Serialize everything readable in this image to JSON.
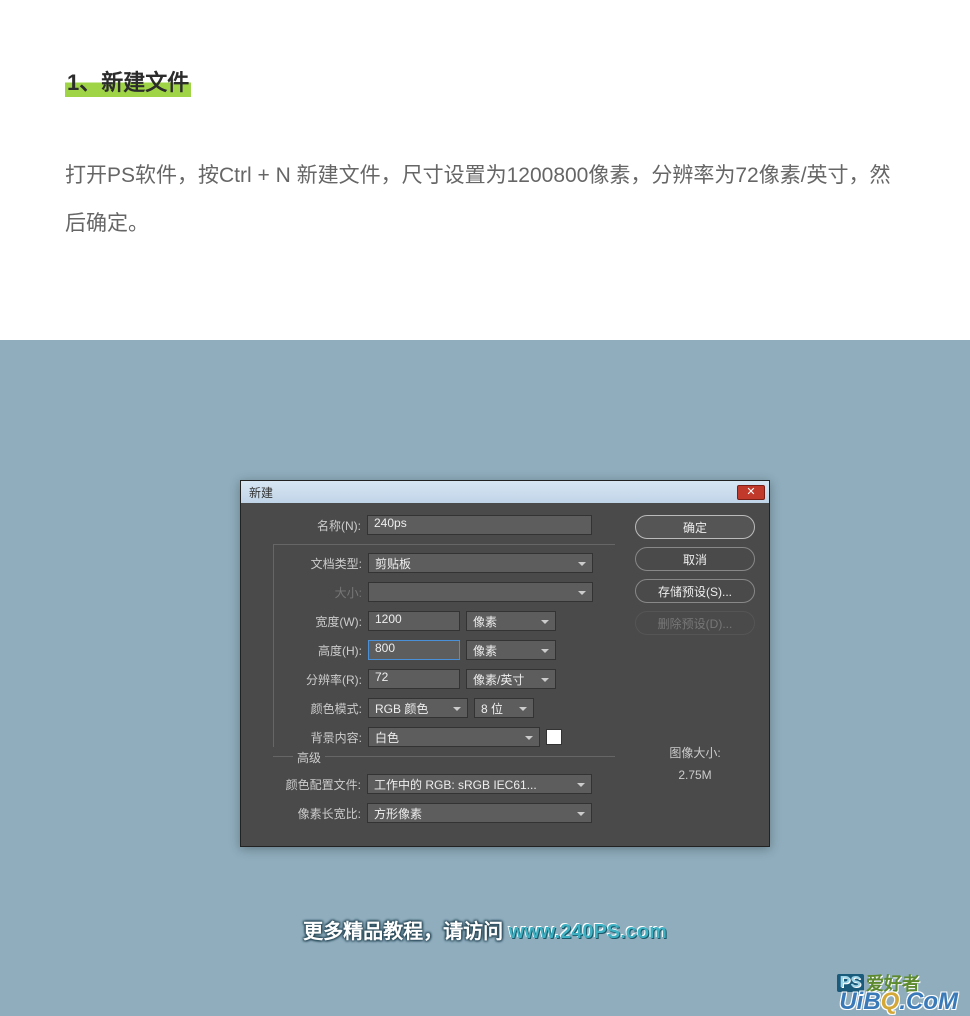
{
  "article": {
    "step_heading": "1、新建文件",
    "step_desc": "打开PS软件，按Ctrl + N 新建文件，尺寸设置为1200800像素，分辨率为72像素/英寸，然后确定。"
  },
  "dialog": {
    "title": "新建",
    "labels": {
      "name": "名称(N):",
      "doctype": "文档类型:",
      "size": "大小:",
      "width": "宽度(W):",
      "height": "高度(H):",
      "resolution": "分辨率(R):",
      "color_mode": "颜色模式:",
      "bg_content": "背景内容:",
      "advanced": "高级",
      "color_profile": "颜色配置文件:",
      "pixel_aspect": "像素长宽比:",
      "image_size_label": "图像大小:"
    },
    "values": {
      "name": "240ps",
      "doctype": "剪贴板",
      "width": "1200",
      "height": "800",
      "resolution": "72",
      "unit_wh": "像素",
      "unit_res": "像素/英寸",
      "color_mode": "RGB 颜色",
      "bit_depth": "8 位",
      "bg_content": "白色",
      "color_profile": "工作中的 RGB: sRGB IEC61...",
      "pixel_aspect": "方形像素",
      "image_size": "2.75M"
    },
    "buttons": {
      "ok": "确定",
      "cancel": "取消",
      "save_preset": "存储预设(S)...",
      "delete_preset": "删除预设(D)..."
    }
  },
  "footer": {
    "line1": "更多精品教程，请访问 ",
    "url": "www.240PS.com"
  },
  "watermark1": {
    "ps": "PS",
    "text": "爱好者"
  },
  "watermark2": {
    "pre": "UiB",
    "q": "Q",
    "post": ".CoM"
  }
}
